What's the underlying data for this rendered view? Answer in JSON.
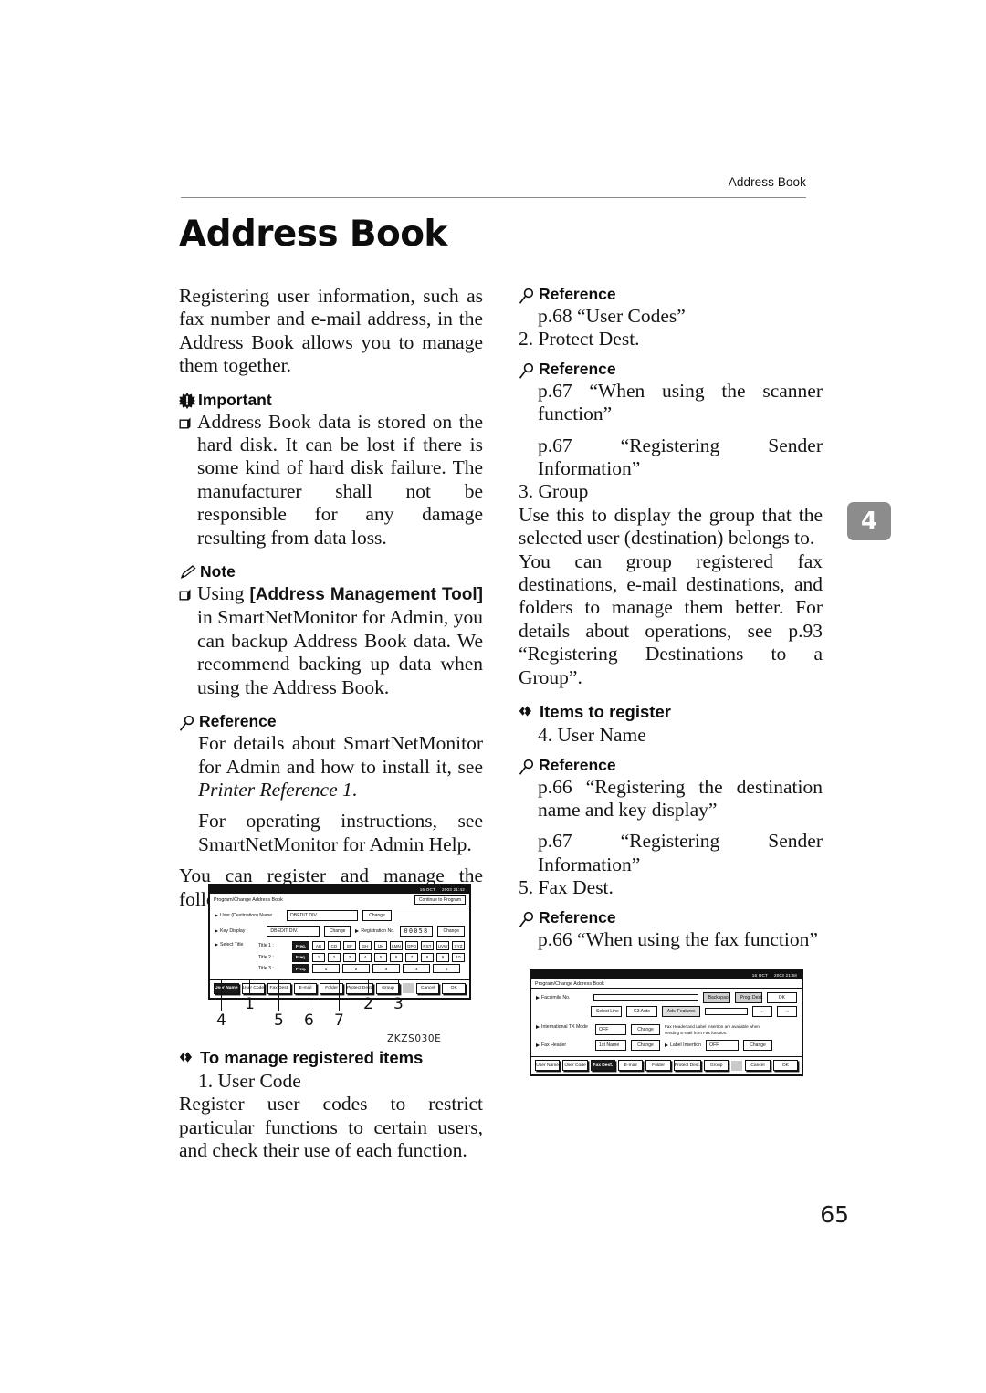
{
  "header": {
    "running_title": "Address Book",
    "chapter_title": "Address Book",
    "chapter_tab": "4",
    "page_number": "65"
  },
  "left_column": {
    "intro": "Registering user information, such as fax number and e-mail address, in the Address Book allows you to manage them together.",
    "important": {
      "heading": "Important",
      "icon": "important-burst-icon",
      "items": [
        "Address Book data is stored on the hard disk. It can be lost if there is some kind of hard disk failure. The manufacturer shall not be responsible for any damage resulting from data loss."
      ]
    },
    "note": {
      "heading": "Note",
      "icon": "note-pencil-icon",
      "item_prefix": "Using ",
      "item_bold": "[Address Management Tool]",
      "item_suffix": " in SmartNetMonitor for Admin, you can backup Address Book data. We recommend backing up data when using the Address Book."
    },
    "reference": {
      "heading": "Reference",
      "icon": "reference-magnifier-icon",
      "para1_pre": "For details about SmartNetMonitor for Admin and how to install it, see ",
      "para1_italic": "Printer Reference 1",
      "para1_post": ".",
      "para2": "For operating instructions, see SmartNetMonitor for Admin Help."
    },
    "lead_in": "You can register and manage the following items in the Address Book:",
    "manage_section": {
      "icon": "diamond-bullet-icon",
      "heading": "To manage registered items",
      "item_number": "1. User Code",
      "item_body": "Register user codes to restrict particular functions to certain users, and check their use of each function."
    }
  },
  "right_column": {
    "ref1": {
      "heading": "Reference",
      "icon": "reference-magnifier-icon",
      "line": "p.68 “User Codes”"
    },
    "item2": "2. Protect Dest.",
    "ref2": {
      "heading": "Reference",
      "icon": "reference-magnifier-icon",
      "line1": "p.67 “When using the scanner function”",
      "line2": "p.67 “Registering Sender Information”"
    },
    "item3": "3. Group",
    "group_body1": "Use this to display the group that the selected user (destination) belongs to.",
    "group_body2": "You can group registered fax destinations, e-mail destinations, and folders to manage them better. For details about operations, see p.93 “Registering Destinations to a Group”.",
    "items_section": {
      "icon": "diamond-bullet-icon",
      "heading": "Items to register",
      "item4": "4. User Name"
    },
    "ref3": {
      "heading": "Reference",
      "icon": "reference-magnifier-icon",
      "line1": "p.66 “Registering the destination name and key display”",
      "line2": "p.67 “Registering Sender Information”"
    },
    "item5": "5. Fax Dest.",
    "ref4": {
      "heading": "Reference",
      "icon": "reference-magnifier-icon",
      "line": "p.66 “When using the fax function”"
    }
  },
  "figure1": {
    "id_label": "ZKZS030E",
    "status_date": "16  OCT",
    "status_time": "2003 21:42",
    "screen_title": "Program/Change Address Book",
    "continue_button": "Continue to Program",
    "rows": [
      {
        "label": "User (Destination) Name",
        "value": "DBEDIT DIV.",
        "button": "Change"
      },
      {
        "label": "Key Display",
        "value": "DBEDIT DIV.",
        "button": "Change"
      }
    ],
    "registration": {
      "label": "Registration No.",
      "value": "00058",
      "button": "Change"
    },
    "select_title_label": "Select Title",
    "titles": [
      {
        "label": "Title 1 :",
        "freq": "Freq.",
        "keys": [
          "AB",
          "CD",
          "EF",
          "GH",
          "IJK",
          "LMN",
          "OPQ",
          "RST",
          "UVW",
          "XYZ"
        ]
      },
      {
        "label": "Title 2 :",
        "freq": "Freq.",
        "keys": [
          "1",
          "2",
          "3",
          "4",
          "5",
          "6",
          "7",
          "8",
          "9",
          "10"
        ]
      },
      {
        "label": "Title 3 :",
        "freq": "Freq.",
        "keys": [
          "1",
          "2",
          "3",
          "4",
          "5"
        ]
      }
    ],
    "tabs": [
      "User Name",
      "User Code",
      "Fax Dest.",
      "E-mail",
      "Folder",
      "Protect Dest.",
      "Group"
    ],
    "tab_selected": "User Name",
    "actions": [
      "Cancel",
      "OK"
    ],
    "callouts": [
      "1",
      "2",
      "3",
      "4",
      "5",
      "6",
      "7"
    ]
  },
  "figure2": {
    "status_date": "16  OCT",
    "status_time": "2003 21:58",
    "screen_title": "Program/Change Address Book",
    "facsimile_label": "Facsimile No.",
    "facsimile_value": "",
    "top_buttons": [
      "Backspace",
      "Prog. Dest.",
      "OK"
    ],
    "line_buttons": [
      "Select Line",
      "G3 Auto",
      "Adv. Features"
    ],
    "cursor_buttons": [
      "←",
      "→"
    ],
    "intl_tx_label": "International TX Mode",
    "intl_tx_value": "OFF",
    "intl_tx_button": "Change",
    "header_note": "Fax Header and Label Insertion are available when sending E-mail from Fax function.",
    "fax_header_label": "Fax Header",
    "fax_header_value": "1st Name",
    "fax_header_button": "Change",
    "label_insertion_label": "Label Insertion",
    "label_insertion_value": "OFF",
    "label_insertion_button": "Change",
    "tabs": [
      "User Name",
      "User Code",
      "Fax Dest.",
      "E-mail",
      "Folder",
      "Protect Dest.",
      "Group"
    ],
    "tab_selected": "Fax Dest.",
    "actions": [
      "Cancel",
      "OK"
    ]
  }
}
